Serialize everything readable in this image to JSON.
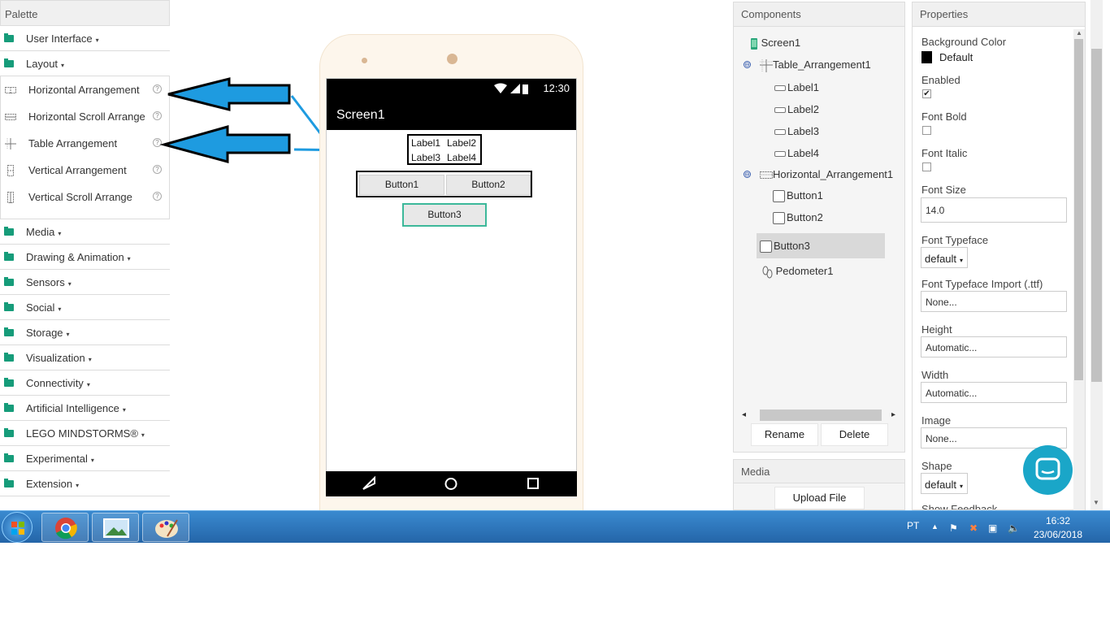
{
  "palette": {
    "title": "Palette",
    "categories_top": [
      {
        "label": "User Interface"
      },
      {
        "label": "Layout"
      }
    ],
    "layout_items": [
      {
        "label": "Horizontal Arrangement",
        "icon": "horizontal-arrangement-icon"
      },
      {
        "label": "Horizontal Scroll Arrange",
        "icon": "horizontal-scroll-icon"
      },
      {
        "label": "Table Arrangement",
        "icon": "table-arrangement-icon"
      },
      {
        "label": "Vertical Arrangement",
        "icon": "vertical-arrangement-icon"
      },
      {
        "label": "Vertical Scroll Arrange",
        "icon": "vertical-scroll-icon"
      }
    ],
    "categories_bottom": [
      {
        "label": "Media"
      },
      {
        "label": "Drawing & Animation"
      },
      {
        "label": "Sensors"
      },
      {
        "label": "Social"
      },
      {
        "label": "Storage"
      },
      {
        "label": "Visualization"
      },
      {
        "label": "Connectivity"
      },
      {
        "label": "Artificial Intelligence"
      },
      {
        "label": "LEGO MINDSTORMS®"
      },
      {
        "label": "Experimental"
      },
      {
        "label": "Extension"
      }
    ],
    "help_glyph": "?",
    "caret": "▾"
  },
  "viewer": {
    "status_time": "12:30",
    "screen_title": "Screen1",
    "labels": [
      "Label1",
      "Label2",
      "Label3",
      "Label4"
    ],
    "buttons": [
      "Button1",
      "Button2",
      "Button3"
    ]
  },
  "components": {
    "title": "Components",
    "tree": {
      "screen": "Screen1",
      "table": "Table_Arrangement1",
      "labels": [
        "Label1",
        "Label2",
        "Label3",
        "Label4"
      ],
      "harr": "Horizontal_Arrangement1",
      "harr_buttons": [
        "Button1",
        "Button2"
      ],
      "selected": "Button3",
      "pedometer": "Pedometer1"
    },
    "collapse_glyph": "⊖",
    "rename_label": "Rename",
    "delete_label": "Delete"
  },
  "media": {
    "title": "Media",
    "upload_label": "Upload File"
  },
  "properties": {
    "title": "Properties",
    "background_color_label": "Background Color",
    "background_color_value": "Default",
    "enabled_label": "Enabled",
    "font_bold_label": "Font Bold",
    "font_italic_label": "Font Italic",
    "font_size_label": "Font Size",
    "font_size_value": "14.0",
    "font_typeface_label": "Font Typeface",
    "font_typeface_value": "default",
    "font_import_label": "Font Typeface Import (.ttf)",
    "font_import_value": "None...",
    "height_label": "Height",
    "height_value": "Automatic...",
    "width_label": "Width",
    "width_value": "Automatic...",
    "image_label": "Image",
    "image_value": "None...",
    "shape_label": "Shape",
    "shape_value": "default",
    "show_feedback_label": "Show Feedback",
    "check_glyph": "✔"
  },
  "taskbar": {
    "language": "PT",
    "time": "16:32",
    "date": "23/06/2018"
  },
  "colors": {
    "accent": "#169c7a",
    "arrow_fill": "#1e9be0",
    "chat_bubble": "#1aa6c8",
    "selection_border": "#3cb89a"
  }
}
